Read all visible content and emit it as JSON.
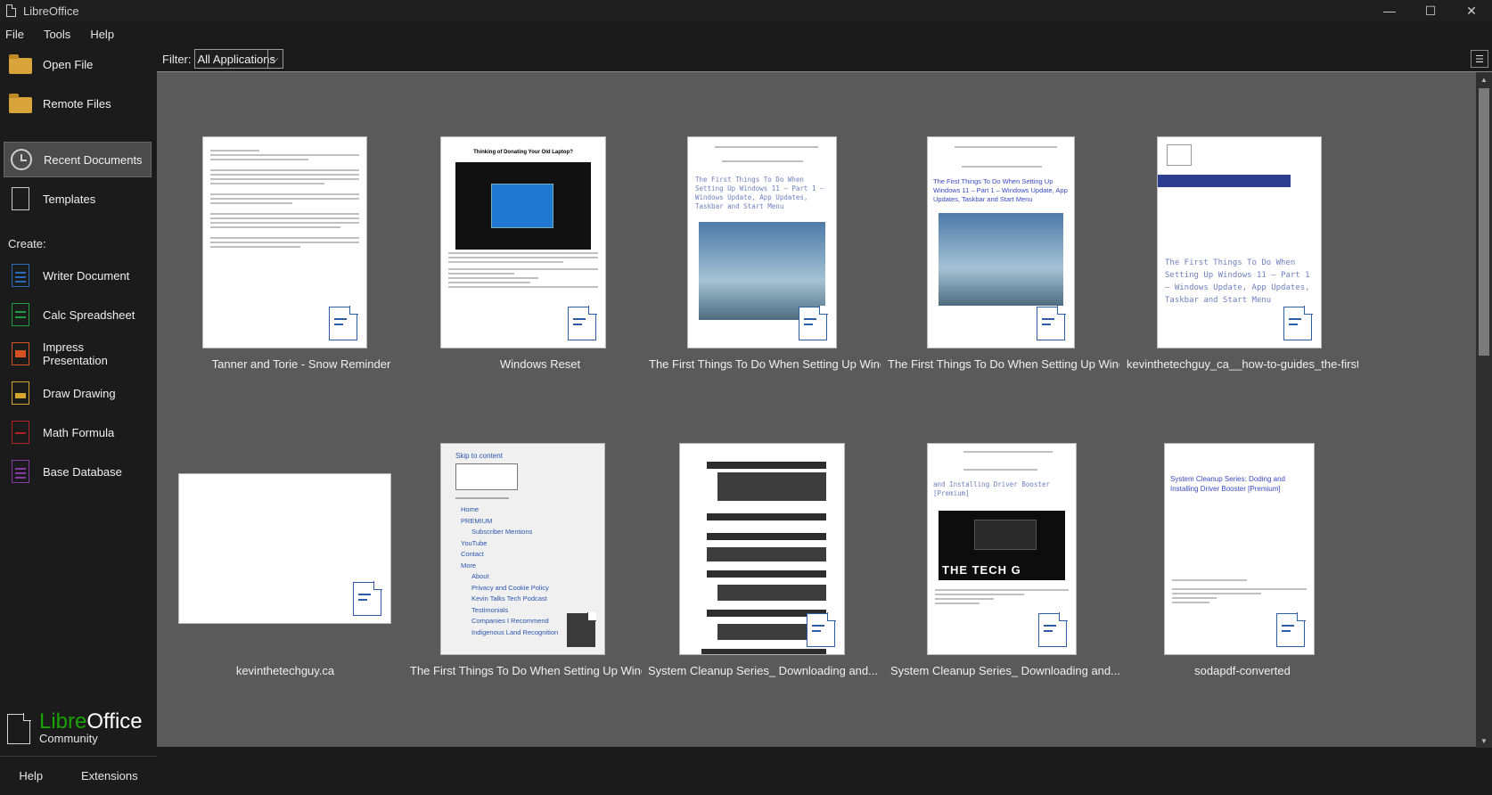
{
  "window": {
    "title": "LibreOffice",
    "minimize": "—",
    "maximize": "☐",
    "close": "✕"
  },
  "menu": [
    "File",
    "Tools",
    "Help"
  ],
  "sidebar": {
    "open_file": "Open File",
    "remote_files": "Remote Files",
    "recent_documents": "Recent Documents",
    "templates": "Templates",
    "create_label": "Create:",
    "create": [
      {
        "label": "Writer Document",
        "color": "#2a6bb8"
      },
      {
        "label": "Calc Spreadsheet",
        "color": "#1f9c3e"
      },
      {
        "label": "Impress Presentation",
        "color": "#d4521f"
      },
      {
        "label": "Draw Drawing",
        "color": "#d6a52b"
      },
      {
        "label": "Math Formula",
        "color": "#b22222"
      },
      {
        "label": "Base Database",
        "color": "#8a3aa8"
      }
    ],
    "brand_libre": "Libre",
    "brand_office": "Office",
    "brand_community": "Community",
    "help": "Help",
    "extensions": "Extensions"
  },
  "filter": {
    "label": "Filter:",
    "value": "All Applications"
  },
  "documents": [
    {
      "label": "Tanner and Torie - Snow Reminder"
    },
    {
      "label": "Windows Reset",
      "heading": "Thinking of Donating Your Old Laptop?"
    },
    {
      "label": "The First Things To Do When Setting Up Window...",
      "heading": "The First Things To Do When Setting Up Windows 11 – Part 1 – Windows Update, App Updates, Taskbar and Start Menu"
    },
    {
      "label": "The First Things To Do When Setting Up Window...",
      "heading": "The First Things To Do When Setting Up Windows 11 – Part 1 – Windows Update, App Updates, Taskbar and Start Menu"
    },
    {
      "label": "kevinthetechguy_ca__how-to-guides_the-first...",
      "heading": "The First Things To Do When Setting Up Windows 11 – Part 1 – Windows Update, App Updates, Taskbar and Start Menu"
    },
    {
      "label": "kevinthetechguy.ca"
    },
    {
      "label": "The First Things To Do When Setting Up Window...",
      "skip": "Skip to content",
      "nav": [
        "Home",
        "PREMIUM",
        "Subscriber Mentions",
        "YouTube",
        "Contact",
        "More",
        "About",
        "Privacy and Cookie Policy",
        "Kevin Talks Tech Podcast",
        "Testimonials",
        "Companies I Recommend",
        "Indigenous Land Recognition"
      ]
    },
    {
      "label": "System Cleanup Series_ Downloading and..."
    },
    {
      "label": "System Cleanup Series_ Downloading and...",
      "heading": "and Installing Driver Booster [Premium]",
      "banner": "THE TECH G"
    },
    {
      "label": "sodapdf-converted",
      "heading": "System Cleanup Series: Doding and Installing Driver Booster [Premium]"
    }
  ]
}
